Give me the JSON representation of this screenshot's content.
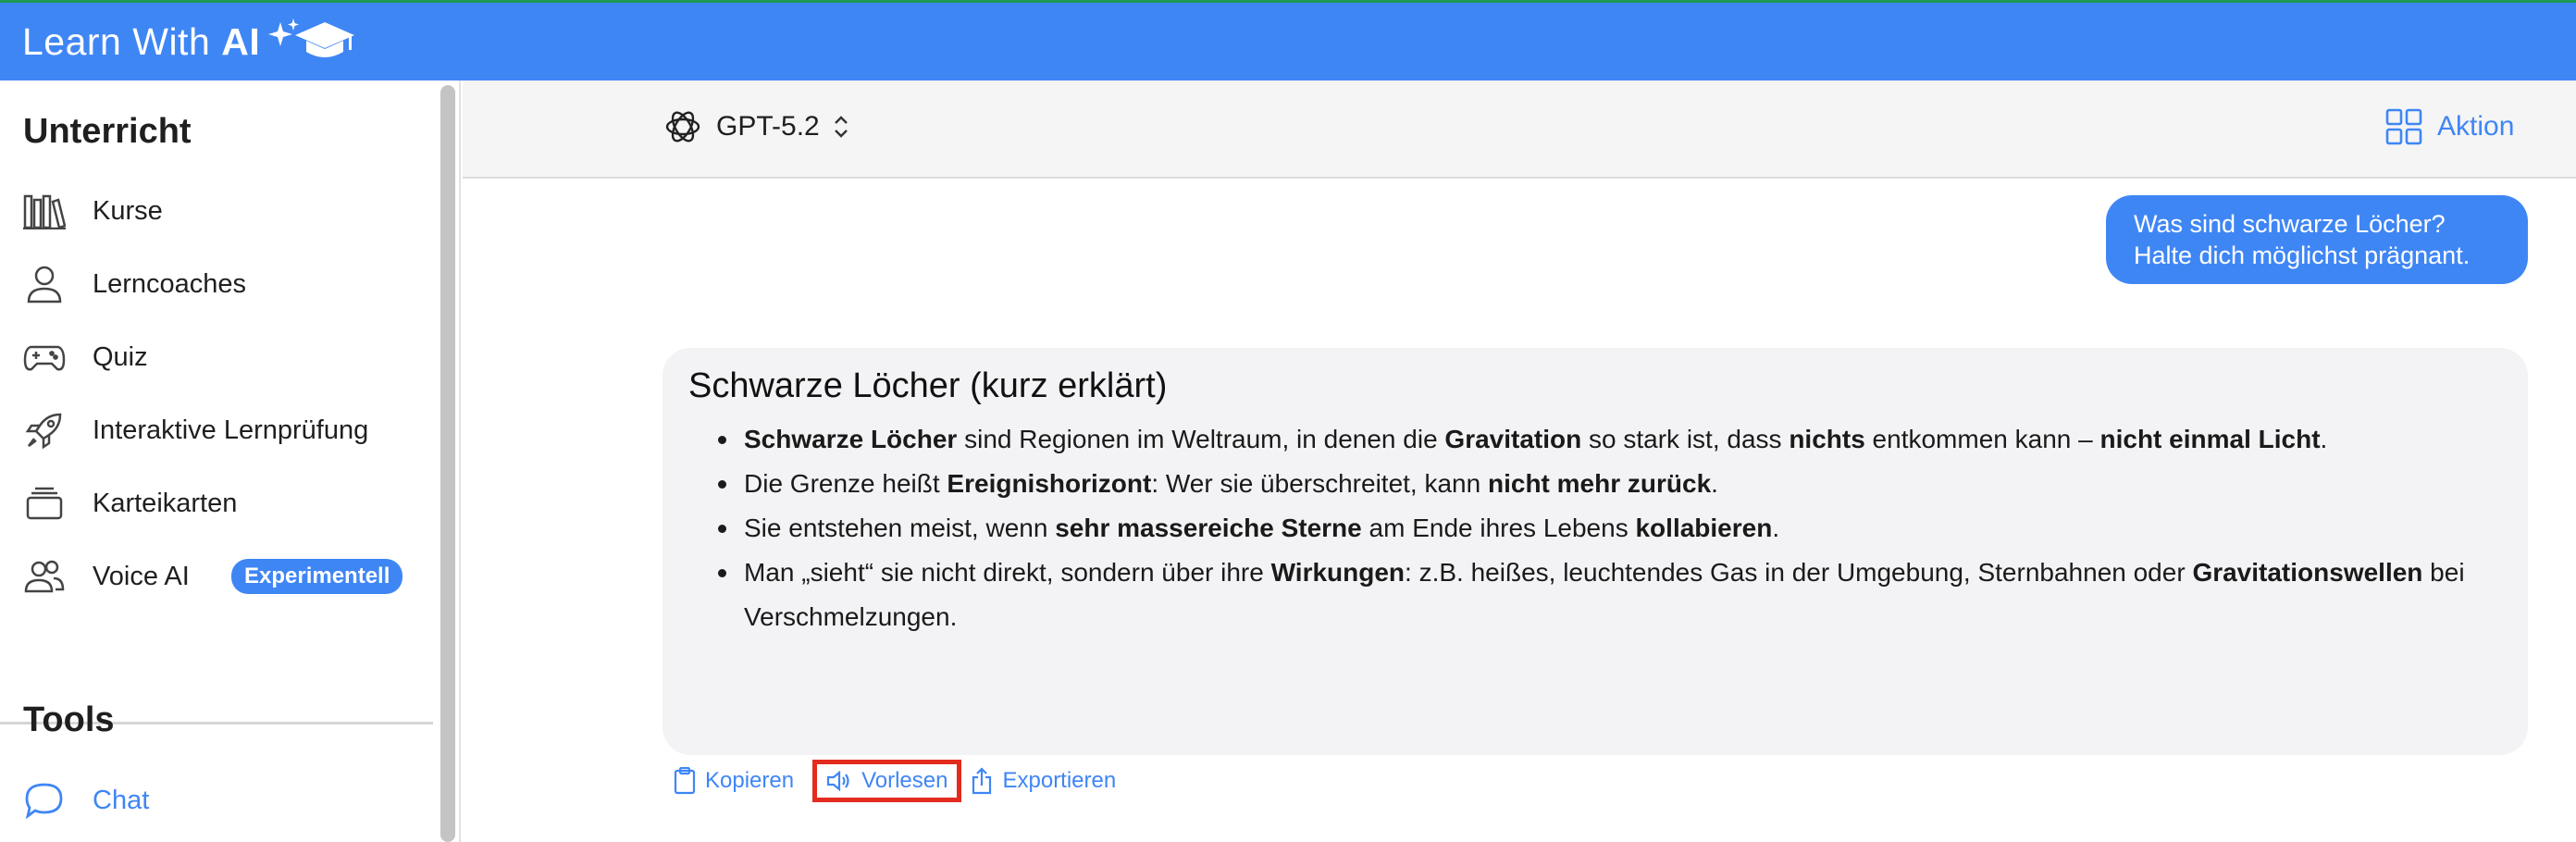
{
  "app": {
    "title_prefix": "Learn With",
    "title_bold": "AI",
    "accent_color": "#3f86f5"
  },
  "sidebar": {
    "section_unterricht": "Unterricht",
    "items": [
      {
        "label": "Kurse",
        "icon": "books-icon"
      },
      {
        "label": "Lerncoaches",
        "icon": "person-icon"
      },
      {
        "label": "Quiz",
        "icon": "gamepad-icon"
      },
      {
        "label": "Interaktive Lernprüfung",
        "icon": "rocket-icon"
      },
      {
        "label": "Karteikarten",
        "icon": "card-stack-icon"
      },
      {
        "label": "Voice AI",
        "icon": "people-icon",
        "badge": "Experimentell"
      }
    ],
    "section_tools": "Tools",
    "tools": [
      {
        "label": "Chat",
        "icon": "chat-bubble-icon",
        "active": true
      }
    ]
  },
  "header": {
    "model_name": "GPT-5.2",
    "action_label": "Aktion"
  },
  "chat": {
    "user_message_line1": "Was sind schwarze Löcher?",
    "user_message_line2": "Halte dich möglichst prägnant.",
    "answer_title": "Schwarze Löcher (kurz erklärt)",
    "bullets": [
      [
        {
          "b": "Schwarze Löcher"
        },
        {
          "t": " sind Regionen im Weltraum, in denen die "
        },
        {
          "b": "Gravitation"
        },
        {
          "t": " so stark ist, dass "
        },
        {
          "b": "nichts"
        },
        {
          "t": " entkommen kann – "
        },
        {
          "b": "nicht einmal Licht"
        },
        {
          "t": "."
        }
      ],
      [
        {
          "t": "Die Grenze heißt "
        },
        {
          "b": "Ereignishorizont"
        },
        {
          "t": ": Wer sie überschreitet, kann "
        },
        {
          "b": "nicht mehr zurück"
        },
        {
          "t": "."
        }
      ],
      [
        {
          "t": "Sie entstehen meist, wenn "
        },
        {
          "b": "sehr massereiche Sterne"
        },
        {
          "t": " am Ende ihres Lebens "
        },
        {
          "b": "kollabieren"
        },
        {
          "t": "."
        }
      ],
      [
        {
          "t": "Man „sieht“ sie nicht direkt, sondern über ihre "
        },
        {
          "b": "Wirkungen"
        },
        {
          "t": ": z.B. heißes, leuchtendes Gas in der Umgebung, Sternbahnen oder "
        },
        {
          "b": "Gravitationswellen"
        },
        {
          "t": " bei Verschmelzungen."
        }
      ]
    ],
    "actions": {
      "copy": "Kopieren",
      "read_aloud": "Vorlesen",
      "export": "Exportieren"
    }
  }
}
